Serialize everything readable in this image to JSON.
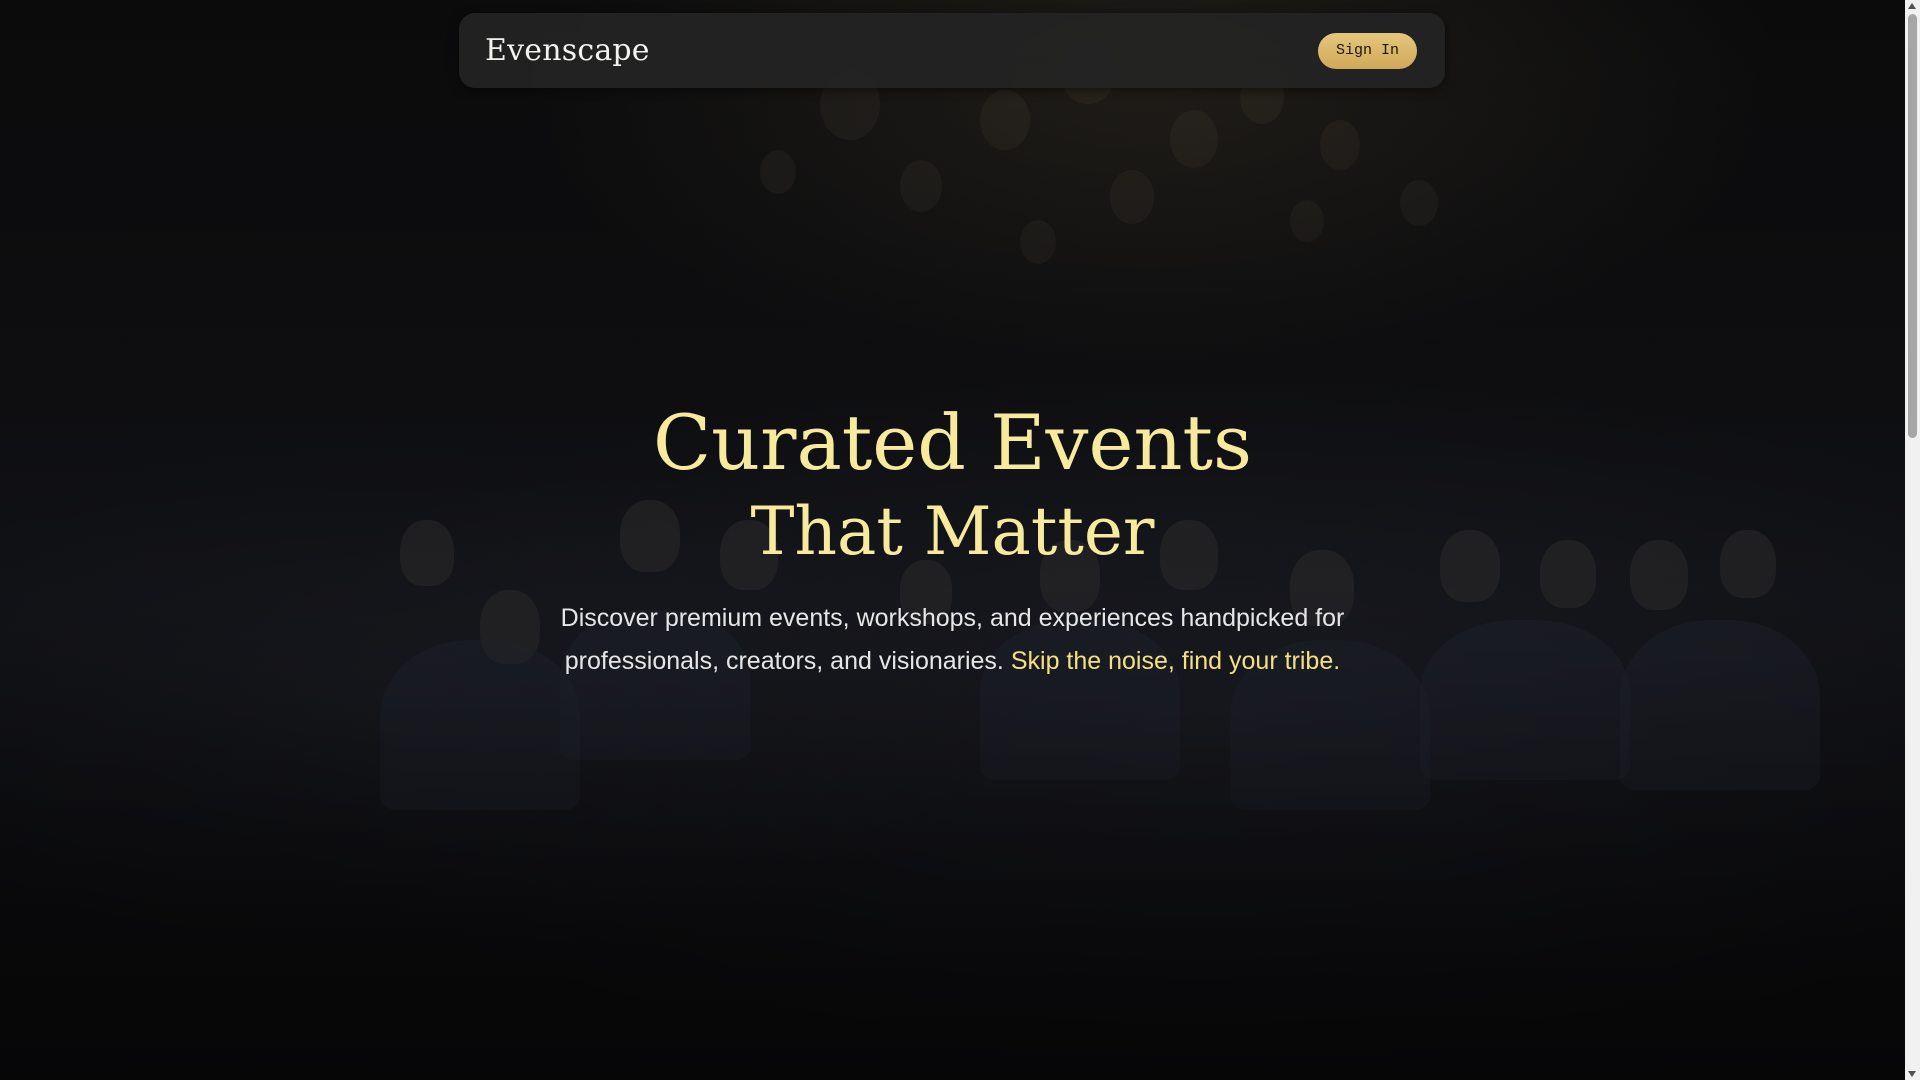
{
  "navbar": {
    "brand": "Evenscape",
    "signin_label": "Sign In"
  },
  "hero": {
    "title_line1": "Curated Events",
    "title_line2": "That Matter",
    "subtitle_main": "Discover premium events, workshops, and experiences handpicked for professionals, creators, and visionaries.",
    "subtitle_accent": "Skip the noise, find your tribe."
  },
  "colors": {
    "background": "#0a0a0b",
    "navbar_bg": "#242424",
    "accent_gold": "#f7ea9c",
    "button_gold": "#d8b766",
    "body_text": "#e6e6e6"
  },
  "background_image": "crowd-audience-photo"
}
